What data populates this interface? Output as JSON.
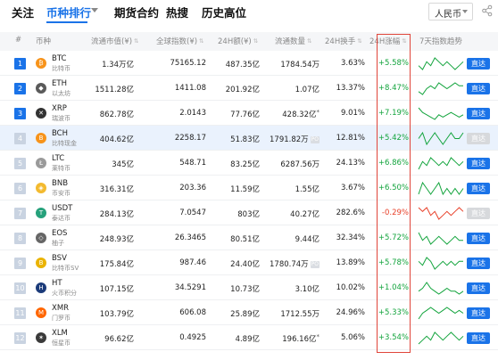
{
  "nav": {
    "items": [
      "关注",
      "币种排行",
      "期货合约",
      "热搜",
      "历史高位"
    ],
    "currency": "人民币"
  },
  "table": {
    "headers": {
      "rank": "#",
      "coin": "币种",
      "mcap": "流通市值(¥)",
      "price": "全球指数(¥)",
      "vol": "24H额(¥)",
      "supply": "流通数量",
      "turnover": "24H换手",
      "change": "24H涨幅",
      "trend": "7天指数趋势"
    },
    "button_label": "直达",
    "rows": [
      {
        "rank": "1",
        "sym": "BTC",
        "cn": "比特币",
        "mcap": "1.34万亿",
        "price": "75165.12",
        "vol": "487.35亿",
        "supply": "1784.54万",
        "supply_badge": "",
        "supply_star": "",
        "turnover": "3.63%",
        "change": "+5.58%",
        "dir": "up",
        "highlight": false,
        "icon_char": "₿",
        "icon_color": "#f7931a",
        "spark": [
          10,
          9,
          11,
          10,
          12,
          11,
          10,
          11,
          10,
          9,
          10,
          11
        ],
        "btn_active": true
      },
      {
        "rank": "2",
        "sym": "ETH",
        "cn": "以太坊",
        "mcap": "1511.28亿",
        "price": "1411.08",
        "vol": "201.92亿",
        "supply": "1.07亿",
        "supply_badge": "",
        "supply_star": "",
        "turnover": "13.37%",
        "change": "+8.47%",
        "dir": "up",
        "highlight": false,
        "icon_char": "◆",
        "icon_color": "#5a5a5a",
        "spark": [
          9,
          8,
          10,
          11,
          10,
          12,
          11,
          10,
          11,
          12,
          11,
          11
        ],
        "btn_active": true
      },
      {
        "rank": "3",
        "sym": "XRP",
        "cn": "瑞波币",
        "mcap": "862.78亿",
        "price": "2.0143",
        "vol": "77.76亿",
        "supply": "428.32亿",
        "supply_badge": "",
        "supply_star": "*",
        "turnover": "9.01%",
        "change": "+7.19%",
        "dir": "up",
        "highlight": false,
        "icon_char": "✕",
        "icon_color": "#333333",
        "spark": [
          13,
          11,
          10,
          9,
          8,
          10,
          9,
          10,
          11,
          10,
          9,
          10
        ],
        "btn_active": true
      },
      {
        "rank": "4",
        "sym": "BCH",
        "cn": "比特现金",
        "mcap": "404.62亿",
        "price": "2258.17",
        "vol": "51.83亿",
        "supply": "1791.82万",
        "supply_badge": "PO",
        "supply_star": "",
        "turnover": "12.81%",
        "change": "+5.42%",
        "dir": "up",
        "highlight": true,
        "icon_char": "B",
        "icon_color": "#f7931a",
        "spark": [
          10,
          11,
          9,
          10,
          11,
          10,
          9,
          10,
          11,
          10,
          10,
          11
        ],
        "btn_active": false
      },
      {
        "rank": "5",
        "sym": "LTC",
        "cn": "莱特币",
        "mcap": "345亿",
        "price": "548.71",
        "vol": "83.25亿",
        "supply": "6287.56万",
        "supply_badge": "",
        "supply_star": "",
        "turnover": "24.13%",
        "change": "+6.86%",
        "dir": "up",
        "highlight": false,
        "icon_char": "Ł",
        "icon_color": "#9a9a9a",
        "spark": [
          9,
          11,
          10,
          12,
          11,
          10,
          11,
          10,
          12,
          11,
          10,
          11
        ],
        "btn_active": true
      },
      {
        "rank": "6",
        "sym": "BNB",
        "cn": "币安币",
        "mcap": "316.31亿",
        "price": "203.36",
        "vol": "11.59亿",
        "supply": "1.55亿",
        "supply_badge": "",
        "supply_star": "",
        "turnover": "3.67%",
        "change": "+6.50%",
        "dir": "up",
        "highlight": false,
        "icon_char": "◈",
        "icon_color": "#f3ba2f",
        "spark": [
          10,
          12,
          11,
          10,
          11,
          12,
          10,
          11,
          10,
          11,
          10,
          11
        ],
        "btn_active": true
      },
      {
        "rank": "7",
        "sym": "USDT",
        "cn": "泰达币",
        "mcap": "284.13亿",
        "price": "7.0547",
        "vol": "803亿",
        "supply": "40.27亿",
        "supply_badge": "",
        "supply_star": "",
        "turnover": "282.6%",
        "change": "-0.29%",
        "dir": "down",
        "highlight": false,
        "icon_char": "T",
        "icon_color": "#26a17b",
        "spark": [
          11,
          10,
          11,
          9,
          10,
          8,
          9,
          10,
          9,
          10,
          11,
          10
        ],
        "btn_active": false
      },
      {
        "rank": "8",
        "sym": "EOS",
        "cn": "柚子",
        "mcap": "248.93亿",
        "price": "26.3465",
        "vol": "80.51亿",
        "supply": "9.44亿",
        "supply_badge": "",
        "supply_star": "",
        "turnover": "32.34%",
        "change": "+5.72%",
        "dir": "up",
        "highlight": false,
        "icon_char": "◇",
        "icon_color": "#666666",
        "spark": [
          12,
          10,
          11,
          9,
          10,
          11,
          10,
          9,
          10,
          11,
          10,
          10
        ],
        "btn_active": true
      },
      {
        "rank": "9",
        "sym": "BSV",
        "cn": "比特币SV",
        "mcap": "175.84亿",
        "price": "987.46",
        "vol": "24.40亿",
        "supply": "1780.74万",
        "supply_badge": "PO",
        "supply_star": "",
        "turnover": "13.89%",
        "change": "+5.78%",
        "dir": "up",
        "highlight": false,
        "icon_char": "B",
        "icon_color": "#eab300",
        "spark": [
          11,
          10,
          12,
          11,
          9,
          10,
          11,
          10,
          11,
          10,
          11,
          11
        ],
        "btn_active": true
      },
      {
        "rank": "10",
        "sym": "HT",
        "cn": "火币积分",
        "mcap": "107.15亿",
        "price": "34.5291",
        "vol": "10.73亿",
        "supply": "3.10亿",
        "supply_badge": "",
        "supply_star": "",
        "turnover": "10.02%",
        "change": "+1.04%",
        "dir": "up",
        "highlight": false,
        "icon_char": "H",
        "icon_color": "#1c3b7a",
        "spark": [
          10,
          11,
          13,
          11,
          10,
          9,
          10,
          11,
          10,
          10,
          9,
          10
        ],
        "btn_active": true
      },
      {
        "rank": "11",
        "sym": "XMR",
        "cn": "门罗币",
        "mcap": "103.79亿",
        "price": "606.08",
        "vol": "25.89亿",
        "supply": "1712.55万",
        "supply_badge": "",
        "supply_star": "",
        "turnover": "24.96%",
        "change": "+5.33%",
        "dir": "up",
        "highlight": false,
        "icon_char": "M",
        "icon_color": "#ff6600",
        "spark": [
          8,
          10,
          11,
          12,
          11,
          10,
          11,
          12,
          11,
          10,
          11,
          10
        ],
        "btn_active": true
      },
      {
        "rank": "12",
        "sym": "XLM",
        "cn": "恒星币",
        "mcap": "96.62亿",
        "price": "0.4925",
        "vol": "4.89亿",
        "supply": "196.16亿",
        "supply_badge": "",
        "supply_star": "*",
        "turnover": "5.06%",
        "change": "+3.54%",
        "dir": "up",
        "highlight": false,
        "icon_char": "✶",
        "icon_color": "#3a3a3a",
        "spark": [
          9,
          10,
          11,
          10,
          12,
          11,
          10,
          11,
          12,
          11,
          10,
          11
        ],
        "btn_active": true
      }
    ]
  },
  "colors": {
    "accent": "#1a73e8",
    "up": "#13a43d",
    "down": "#e8412a",
    "highlight_frame": "#e0453a"
  }
}
